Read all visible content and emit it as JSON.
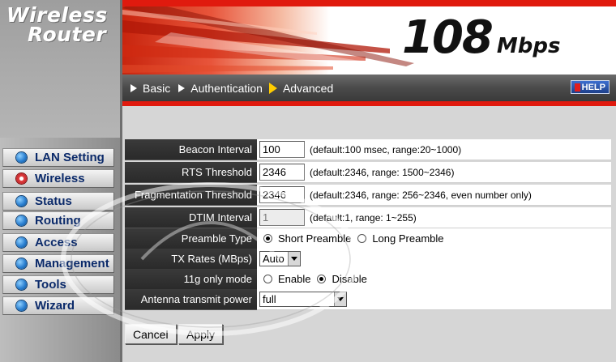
{
  "brand": {
    "line1": "Wireless",
    "line2": "Router",
    "speed_num": "108",
    "speed_unit": "Mbps"
  },
  "nav": [
    {
      "label": "LAN Setting",
      "active": false
    },
    {
      "label": "Wireless",
      "active": true
    },
    {
      "label": "Status",
      "active": false
    },
    {
      "label": "Routing",
      "active": false
    },
    {
      "label": "Access",
      "active": false
    },
    {
      "label": "Management",
      "active": false
    },
    {
      "label": "Tools",
      "active": false
    },
    {
      "label": "Wizard",
      "active": false
    }
  ],
  "tabs": [
    {
      "label": "Basic",
      "active": false
    },
    {
      "label": "Authentication",
      "active": false
    },
    {
      "label": "Advanced",
      "active": true
    }
  ],
  "help": "HELP",
  "form": {
    "beacon": {
      "label": "Beacon Interval",
      "value": "100",
      "hint": "(default:100 msec, range:20~1000)"
    },
    "rts": {
      "label": "RTS Threshold",
      "value": "2346",
      "hint": "(default:2346, range: 1500~2346)"
    },
    "frag": {
      "label": "Fragmentation Threshold",
      "value": "2346",
      "hint": "(default:2346, range: 256~2346, even number only)"
    },
    "dtim": {
      "label": "DTIM Interval",
      "value": "1",
      "hint": "(default:1, range: 1~255)"
    },
    "preamble": {
      "label": "Preamble Type",
      "opt1": "Short Preamble",
      "opt2": "Long Preamble",
      "selected": "Short Preamble"
    },
    "txrates": {
      "label": "TX Rates (MBps)",
      "value": "Auto"
    },
    "g_only": {
      "label": "11g only mode",
      "opt1": "Enable",
      "opt2": "Disable",
      "selected": "Disable"
    },
    "antenna": {
      "label": "Antenna transmit power",
      "value": "full"
    }
  },
  "buttons": {
    "cancel": "Cancel",
    "apply": "Apply"
  },
  "colors": {
    "accent_red": "#e01a0e",
    "nav_text": "#0b2a6a",
    "label_bg": "#2e2e2e"
  }
}
